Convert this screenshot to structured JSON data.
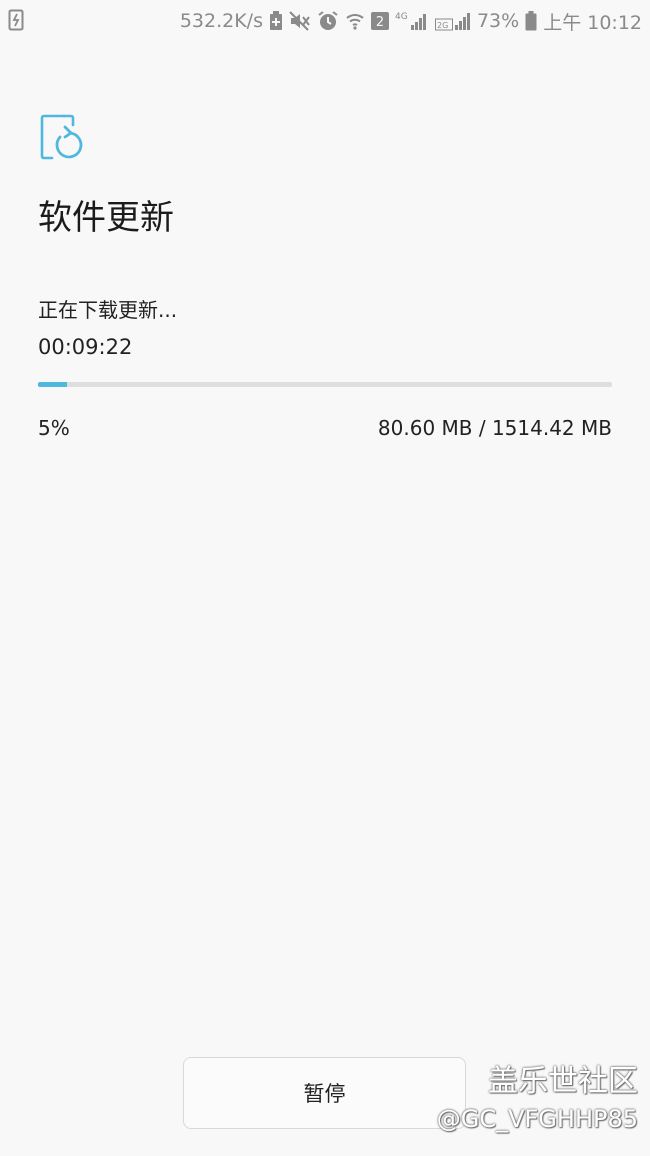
{
  "status_bar": {
    "network_speed": "532.2K/s",
    "sim_slot": "2",
    "network_type": "4G",
    "secondary_network": "2G",
    "battery_level": "73%",
    "time": "上午 10:12",
    "icon_color": "#8a8a8a"
  },
  "header": {
    "app_icon": "software-update-icon",
    "title": "软件更新",
    "accent_color": "#4fb8de"
  },
  "download": {
    "status_text": "正在下载更新...",
    "elapsed_time": "00:09:22",
    "progress_percent": 5,
    "progress_label": "5%",
    "size_label": "80.60 MB / 1514.42 MB"
  },
  "actions": {
    "pause_label": "暂停"
  },
  "watermark": {
    "site": "盖乐世社区",
    "user": "@GC_VFGHHP85"
  }
}
